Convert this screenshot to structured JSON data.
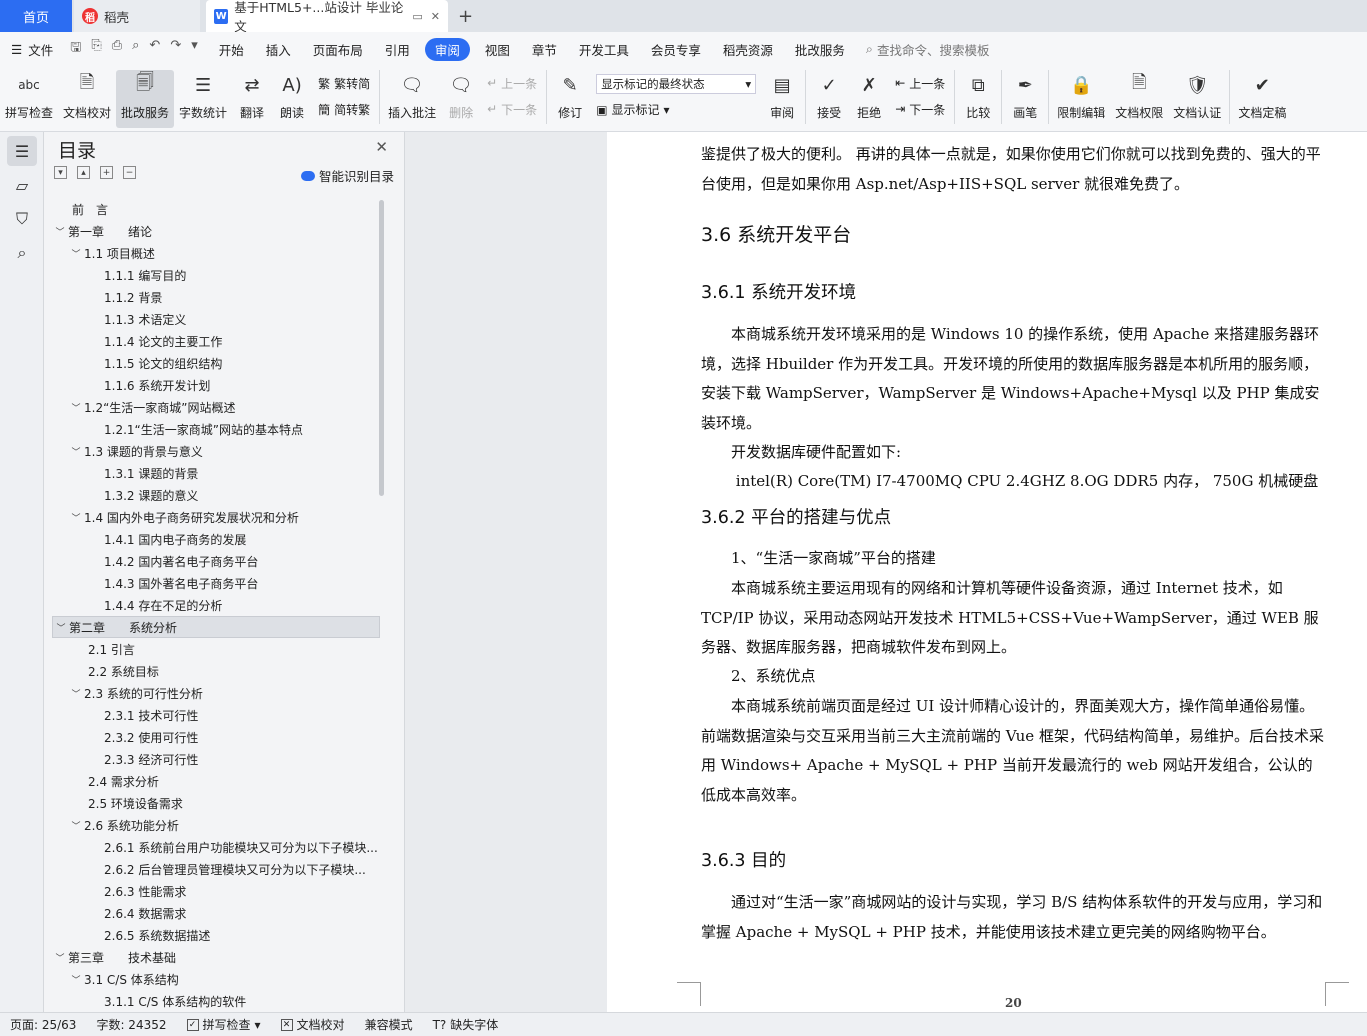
{
  "tabs": {
    "home": "首页",
    "daoke": "稻壳",
    "doc": "基于HTML5+...站设计 毕业论文"
  },
  "menu": {
    "file": "文件",
    "items": [
      "开始",
      "插入",
      "页面布局",
      "引用",
      "审阅",
      "视图",
      "章节",
      "开发工具",
      "会员专享",
      "稻壳资源",
      "批改服务"
    ],
    "active": "审阅",
    "search_placeholder": "查找命令、搜索模板"
  },
  "ribbon": {
    "spell": "拼写检查",
    "proof": "文档校对",
    "review_service": "批改服务",
    "word_count": "字数统计",
    "translate": "翻译",
    "read_aloud": "朗读",
    "to_traditional": "繁转简",
    "to_simplified": "简转繁",
    "insert_comment": "插入批注",
    "delete": "删除",
    "prev": "上一条",
    "next": "下一条",
    "track": "修订",
    "markup_state": "显示标记的最终状态",
    "show_markup": "显示标记",
    "review": "审阅",
    "accept": "接受",
    "reject": "拒绝",
    "prev2": "上一条",
    "next2": "下一条",
    "compare": "比较",
    "pen": "画笔",
    "restrict": "限制编辑",
    "permission": "文档权限",
    "certify": "文档认证",
    "finalize": "文档定稿"
  },
  "toc": {
    "title": "目录",
    "smart": "智能识别目录",
    "items": [
      {
        "text": "前　言",
        "level": 1,
        "arrow": ""
      },
      {
        "text": "第一章　　绪论",
        "level": 1,
        "arrow": "v"
      },
      {
        "text": "1.1 项目概述",
        "level": 2,
        "arrow": "v"
      },
      {
        "text": "1.1.1  编写目的",
        "level": 3,
        "arrow": ""
      },
      {
        "text": "1.1.2  背景",
        "level": 3,
        "arrow": ""
      },
      {
        "text": "1.1.3  术语定义",
        "level": 3,
        "arrow": ""
      },
      {
        "text": "1.1.4  论文的主要工作",
        "level": 3,
        "arrow": ""
      },
      {
        "text": "1.1.5  论文的组织结构",
        "level": 3,
        "arrow": ""
      },
      {
        "text": "1.1.6  系统开发计划",
        "level": 3,
        "arrow": ""
      },
      {
        "text": "1.2“生活一家商城”网站概述",
        "level": 2,
        "arrow": "v"
      },
      {
        "text": "1.2.1“生活一家商城”网站的基本特点",
        "level": 3,
        "arrow": ""
      },
      {
        "text": "1.3 课题的背景与意义",
        "level": 2,
        "arrow": "v"
      },
      {
        "text": "1.3.1  课题的背景",
        "level": 3,
        "arrow": ""
      },
      {
        "text": "1.3.2  课题的意义",
        "level": 3,
        "arrow": ""
      },
      {
        "text": "1.4 国内外电子商务研究发展状况和分析",
        "level": 2,
        "arrow": "v"
      },
      {
        "text": "1.4.1 国内电子商务的发展",
        "level": 3,
        "arrow": ""
      },
      {
        "text": "1.4.2 国内著名电子商务平台",
        "level": 3,
        "arrow": ""
      },
      {
        "text": "1.4.3 国外著名电子商务平台",
        "level": 3,
        "arrow": ""
      },
      {
        "text": "1.4.4 存在不足的分析",
        "level": 3,
        "arrow": ""
      },
      {
        "text": "第二章　　系统分析",
        "level": 1,
        "arrow": "v",
        "selected": true
      },
      {
        "text": "2.1  引言",
        "level": 2,
        "arrow": ""
      },
      {
        "text": "2.2  系统目标",
        "level": 2,
        "arrow": ""
      },
      {
        "text": "2.3  系统的可行性分析",
        "level": 2,
        "arrow": "v"
      },
      {
        "text": "2.3.1  技术可行性",
        "level": 3,
        "arrow": ""
      },
      {
        "text": "2.3.2  使用可行性",
        "level": 3,
        "arrow": ""
      },
      {
        "text": "2.3.3  经济可行性",
        "level": 3,
        "arrow": ""
      },
      {
        "text": "2.4 需求分析",
        "level": 2,
        "arrow": ""
      },
      {
        "text": "2.5  环境设备需求",
        "level": 2,
        "arrow": ""
      },
      {
        "text": "2.6 系统功能分析",
        "level": 2,
        "arrow": "v"
      },
      {
        "text": "2.6.1 系统前台用户功能模块又可分为以下子模块...",
        "level": 3,
        "arrow": ""
      },
      {
        "text": "2.6.2 后台管理员管理模块又可分为以下子模块...",
        "level": 3,
        "arrow": ""
      },
      {
        "text": "2.6.3  性能需求",
        "level": 3,
        "arrow": ""
      },
      {
        "text": "2.6.4  数据需求",
        "level": 3,
        "arrow": ""
      },
      {
        "text": "2.6.5  系统数据描述",
        "level": 3,
        "arrow": ""
      },
      {
        "text": "第三章　　技术基础",
        "level": 1,
        "arrow": "v"
      },
      {
        "text": "3.1 C/S 体系结构",
        "level": 2,
        "arrow": "v"
      },
      {
        "text": "3.1.1 C/S 体系结构的软件",
        "level": 3,
        "arrow": ""
      }
    ]
  },
  "doc": {
    "p0": "鉴提供了极大的便利。 再讲的具体一点就是，如果你使用它们你就可以找到免费的、强大的平台使用，但是如果你用 Asp.net/Asp+IIS+SQL server 就很难免费了。",
    "h_36": "3.6 系统开发平台",
    "h_361": "3.6.1 系统开发环境",
    "p1": "　　本商城系统开发环境采用的是 Windows 10 的操作系统，使用 Apache 来搭建服务器环境，选择 Hbuilder 作为开发工具。开发环境的所使用的数据库服务器是本机所用的服务顺，安装下载 WampServer，WampServer 是 Windows+Apache+Mysql 以及 PHP 集成安装环境。",
    "p2": "　　开发数据库硬件配置如下:",
    "p3": "　　 intel(R) Core(TM) I7-4700MQ CPU 2.4GHZ 8.OG DDR5 内存， 750G  机械硬盘",
    "h_362": "3.6.2 平台的搭建与优点",
    "p4": "　　1、“生活一家商城”平台的搭建",
    "p5": "　　本商城系统主要运用现有的网络和计算机等硬件设备资源，通过 Internet 技术，如 TCP/IP 协议，采用动态网站开发技术 HTML5+CSS+Vue+WampServer，通过 WEB 服务器、数据库服务器，把商城软件发布到网上。",
    "p6": "　　2、系统优点",
    "p7": "　　本商城系统前端页面是经过 UI 设计师精心设计的，界面美观大方，操作简单通俗易懂。前端数据渲染与交互采用当前三大主流前端的 Vue 框架，代码结构简单，易维护。后台技术采用 Windows+ Apache + MySQL + PHP  当前开发最流行的 web 网站开发组合，公认的低成本高效率。",
    "h_363": "3.6.3  目的",
    "p8": "　　通过对“生活一家”商城网站的设计与实现，学习 B/S 结构体系软件的开发与应用，学习和掌握 Apache + MySQL + PHP 技术，并能使用该技术建立更完美的网络购物平台。",
    "page_number": "20"
  },
  "status": {
    "page": "页面: 25/63",
    "words": "字数: 24352",
    "spell": "拼写检查",
    "proof": "文档校对",
    "compat": "兼容模式",
    "missing_font": "缺失字体"
  }
}
